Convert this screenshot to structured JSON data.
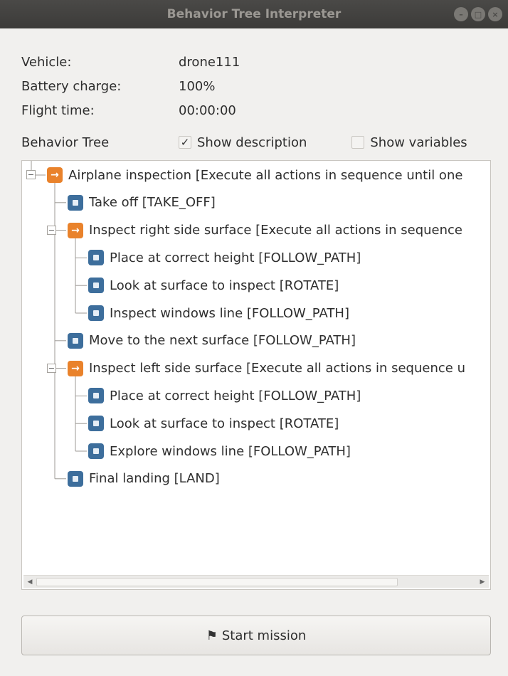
{
  "window": {
    "title": "Behavior Tree Interpreter"
  },
  "info": {
    "vehicle_label": "Vehicle:",
    "vehicle_value": "drone111",
    "battery_label": "Battery charge:",
    "battery_value": "100%",
    "flight_label": "Flight time:",
    "flight_value": "00:00:00"
  },
  "tree_header": {
    "title": "Behavior Tree",
    "show_description_label": "Show description",
    "show_description_checked": true,
    "show_variables_label": "Show variables",
    "show_variables_checked": false
  },
  "tree": {
    "nodes": [
      {
        "label": "Airplane inspection [Execute all actions in sequence until one",
        "type": "sequence",
        "depth": 0,
        "expandable": true
      },
      {
        "label": "Take off [TAKE_OFF]",
        "type": "action",
        "depth": 1
      },
      {
        "label": "Inspect right side surface [Execute all actions in sequence",
        "type": "sequence",
        "depth": 1,
        "expandable": true
      },
      {
        "label": "Place at correct height [FOLLOW_PATH]",
        "type": "action",
        "depth": 2
      },
      {
        "label": "Look at surface to inspect [ROTATE]",
        "type": "action",
        "depth": 2
      },
      {
        "label": "Inspect windows line [FOLLOW_PATH]",
        "type": "action",
        "depth": 2
      },
      {
        "label": "Move to the next surface [FOLLOW_PATH]",
        "type": "action",
        "depth": 1
      },
      {
        "label": "Inspect left side surface [Execute all actions in sequence u",
        "type": "sequence",
        "depth": 1,
        "expandable": true
      },
      {
        "label": "Place at correct height [FOLLOW_PATH]",
        "type": "action",
        "depth": 2
      },
      {
        "label": "Look at surface to inspect [ROTATE]",
        "type": "action",
        "depth": 2
      },
      {
        "label": "Explore windows line [FOLLOW_PATH]",
        "type": "action",
        "depth": 2
      },
      {
        "label": "Final landing [LAND]",
        "type": "action",
        "depth": 1
      }
    ]
  },
  "buttons": {
    "start_mission": "Start mission"
  },
  "colors": {
    "sequence_icon": "#e9822b",
    "action_icon": "#3d6e9c",
    "titlebar": "#3c3b39"
  },
  "icons": {
    "sequence": "arrow-right-icon",
    "action": "square-dot-icon",
    "start": "flag-icon"
  }
}
